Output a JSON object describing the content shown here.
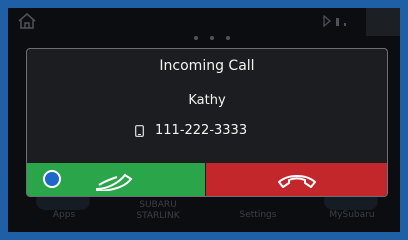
{
  "incoming_call": {
    "title": "Incoming Call",
    "caller_name": "Kathy",
    "phone_number": "111-222-3333"
  },
  "background": {
    "dock": [
      "Apps",
      "SUBARU\nSTARLINK",
      "Settings",
      "MySubaru"
    ]
  },
  "colors": {
    "accept": "#2aa54a",
    "decline": "#c3262b",
    "frame": "#1f5fa5"
  }
}
